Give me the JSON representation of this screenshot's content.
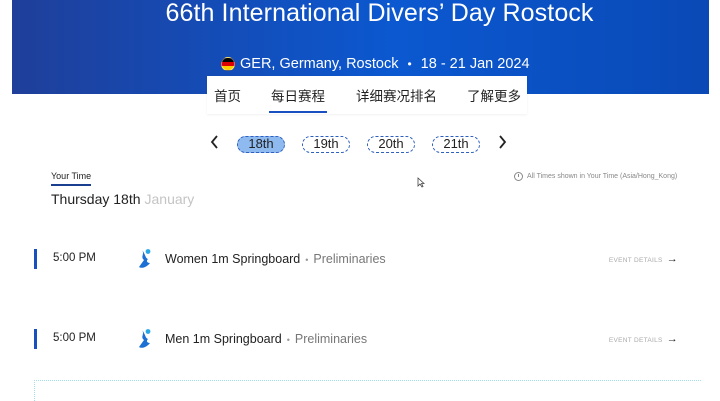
{
  "header": {
    "title": "66th International Divers’ Day Rostock",
    "location": "GER, Germany, Rostock",
    "dates": "18 - 21 Jan 2024"
  },
  "tabs": [
    {
      "label": "首页",
      "active": false
    },
    {
      "label": "每日赛程",
      "active": true
    },
    {
      "label": "详细赛况排名",
      "active": false
    },
    {
      "label": "了解更多",
      "active": false
    }
  ],
  "date_nav": {
    "prev_icon": "chevron-left-icon",
    "next_icon": "chevron-right-icon",
    "days": [
      {
        "label": "18th",
        "selected": true
      },
      {
        "label": "19th",
        "selected": false
      },
      {
        "label": "20th",
        "selected": false
      },
      {
        "label": "21th",
        "selected": false
      }
    ]
  },
  "schedule": {
    "your_time_label": "Your Time",
    "timezone_note": "All Times shown in Your Time (Asia/Hong_Kong)",
    "day_label": "Thursday 18th",
    "month_label": "January",
    "events": [
      {
        "time": "5:00 PM",
        "name": "Women 1m Springboard",
        "phase": "Preliminaries",
        "details_label": "EVENT DETAILS"
      },
      {
        "time": "5:00 PM",
        "name": "Men 1m Springboard",
        "phase": "Preliminaries",
        "details_label": "EVENT DETAILS"
      }
    ]
  },
  "colors": {
    "brand_blue": "#0b58d0",
    "accent": "#1a4fc0",
    "selected_day": "#8fbaf0"
  }
}
